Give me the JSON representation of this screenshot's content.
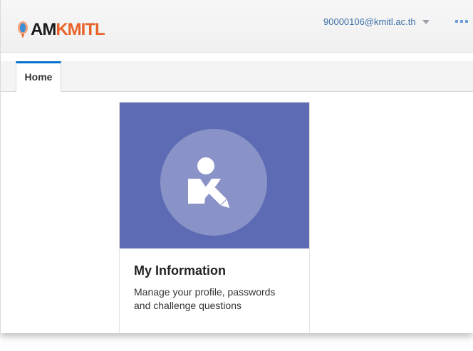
{
  "header": {
    "logo": {
      "prefix": "AM",
      "suffix": "KMITL"
    },
    "user_email": "90000106@kmitl.ac.th",
    "icons": {
      "logo_mark": "balloon-pin-icon",
      "user_dropdown": "caret-down-icon",
      "more": "more-dots-icon"
    }
  },
  "tabs": [
    {
      "label": "Home",
      "active": true
    }
  ],
  "tiles": [
    {
      "title": "My Information",
      "description": "Manage your profile, passwords and challenge questions",
      "icon": "user-edit-icon"
    }
  ],
  "colors": {
    "tile_banner": "#5c6bb3",
    "tile_circle": "#8a93c8",
    "logo_orange": "#e8632a",
    "tab_accent": "#0572ce",
    "link_blue": "#3a6ea5"
  }
}
